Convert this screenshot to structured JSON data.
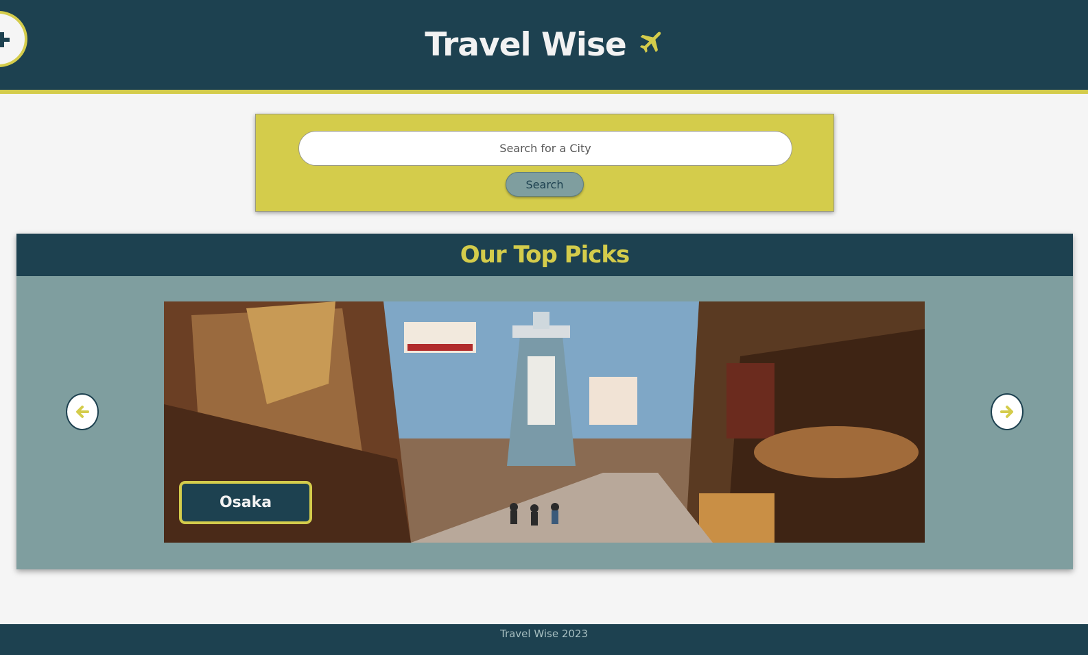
{
  "header": {
    "title": "Travel Wise",
    "title_icon": "airplane-icon",
    "add_button_icon": "plus-icon"
  },
  "search": {
    "placeholder": "Search for a City",
    "button_label": "Search"
  },
  "top_picks": {
    "heading": "Our Top Picks",
    "current_city": "Osaka",
    "prev_icon": "arrow-left-icon",
    "next_icon": "arrow-right-icon"
  },
  "footer": {
    "text": "Travel Wise 2023"
  },
  "colors": {
    "primary": "#1d4150",
    "accent": "#d4cc4b",
    "muted": "#7f9e9f",
    "background": "#f5f5f5"
  }
}
